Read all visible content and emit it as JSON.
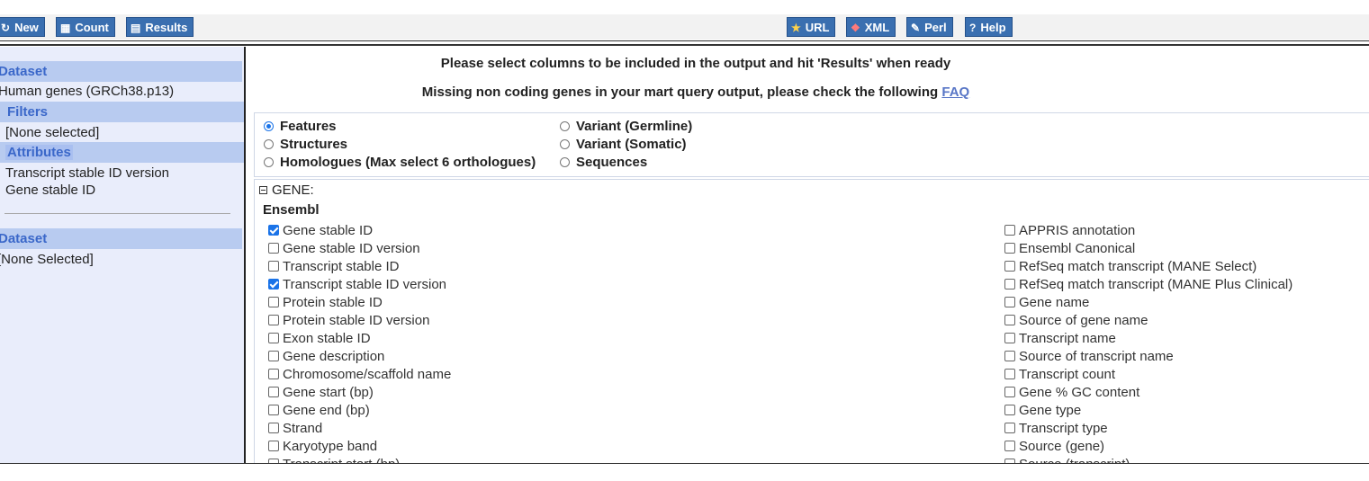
{
  "toolbar": {
    "left_buttons": [
      {
        "label": "New",
        "icon": "refresh-icon"
      },
      {
        "label": "Count",
        "icon": "calculator-icon"
      },
      {
        "label": "Results",
        "icon": "table-icon"
      }
    ],
    "right_buttons": [
      {
        "label": "URL",
        "icon": "star-icon"
      },
      {
        "label": "XML",
        "icon": "xml-file-icon"
      },
      {
        "label": "Perl",
        "icon": "script-icon"
      },
      {
        "label": "Help",
        "icon": "help-icon"
      }
    ]
  },
  "sidebar": {
    "dataset_header": "Dataset",
    "dataset_value": "Human genes (GRCh38.p13)",
    "filters_header": "Filters",
    "filters_value": "[None selected]",
    "attributes_header": "Attributes",
    "attributes_values": [
      "Transcript stable ID version",
      "Gene stable ID"
    ],
    "dataset2_header": "Dataset",
    "dataset2_value": "[None Selected]"
  },
  "main": {
    "instruction": "Please select columns to be included in the output and hit 'Results' when ready",
    "notice": "Missing non coding genes in your mart query output, please check the following",
    "faq_link": "FAQ",
    "attribute_pages": [
      {
        "label": "Features",
        "selected": true
      },
      {
        "label": "Structures",
        "selected": false
      },
      {
        "label": "Homologues (Max select 6 orthologues)",
        "selected": false
      },
      {
        "label": "Variant (Germline)",
        "selected": false
      },
      {
        "label": "Variant (Somatic)",
        "selected": false
      },
      {
        "label": "Sequences",
        "selected": false
      }
    ],
    "section_title": "GENE:",
    "group_title": "Ensembl",
    "left_attributes": [
      {
        "label": "Gene stable ID",
        "checked": true
      },
      {
        "label": "Gene stable ID version",
        "checked": false
      },
      {
        "label": "Transcript stable ID",
        "checked": false
      },
      {
        "label": "Transcript stable ID version",
        "checked": true
      },
      {
        "label": "Protein stable ID",
        "checked": false
      },
      {
        "label": "Protein stable ID version",
        "checked": false
      },
      {
        "label": "Exon stable ID",
        "checked": false
      },
      {
        "label": "Gene description",
        "checked": false
      },
      {
        "label": "Chromosome/scaffold name",
        "checked": false
      },
      {
        "label": "Gene start (bp)",
        "checked": false
      },
      {
        "label": "Gene end (bp)",
        "checked": false
      },
      {
        "label": "Strand",
        "checked": false
      },
      {
        "label": "Karyotype band",
        "checked": false
      },
      {
        "label": "Transcript start (bp)",
        "checked": false
      }
    ],
    "right_attributes": [
      {
        "label": "APPRIS annotation",
        "checked": false
      },
      {
        "label": "Ensembl Canonical",
        "checked": false
      },
      {
        "label": "RefSeq match transcript (MANE Select)",
        "checked": false
      },
      {
        "label": "RefSeq match transcript (MANE Plus Clinical)",
        "checked": false
      },
      {
        "label": "Gene name",
        "checked": false
      },
      {
        "label": "Source of gene name",
        "checked": false
      },
      {
        "label": "Transcript name",
        "checked": false
      },
      {
        "label": "Source of transcript name",
        "checked": false
      },
      {
        "label": "Transcript count",
        "checked": false
      },
      {
        "label": "Gene % GC content",
        "checked": false
      },
      {
        "label": "Gene type",
        "checked": false
      },
      {
        "label": "Transcript type",
        "checked": false
      },
      {
        "label": "Source (gene)",
        "checked": false
      },
      {
        "label": "Source (transcript)",
        "checked": false
      }
    ]
  },
  "colors": {
    "button_bg": "#3a6fb0",
    "sidebar_bg": "#e9edfb",
    "sidebar_header_bg": "#b8cbf0",
    "sidebar_header_text": "#3a67c9",
    "checkbox_checked": "#1a73e8",
    "link": "#5876c6"
  }
}
